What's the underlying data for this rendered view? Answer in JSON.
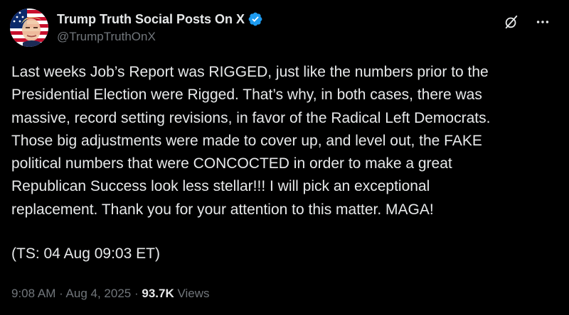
{
  "author": {
    "display_name": "Trump Truth Social Posts On X",
    "handle": "@TrumpTruthOnX",
    "verified": true
  },
  "post": {
    "text": "Last weeks Job’s Report was RIGGED, just like the numbers prior to the\nPresidential Election were Rigged. That’s why, in both cases, there was\nmassive, record setting revisions, in favor of the Radical Left Democrats.\nThose big adjustments were made to cover up, and level out, the FAKE\npolitical numbers that were CONCOCTED in order to make a great\nRepublican Success look less stellar!!! I will pick an exceptional\nreplacement. Thank you for your attention to this matter. MAGA!",
    "timestamp_line": "(TS: 04 Aug 09:03 ET)"
  },
  "meta": {
    "time": "9:08 AM",
    "separator": " · ",
    "date": "Aug 4, 2025",
    "views_count": "93.7K",
    "views_label": " Views"
  },
  "icons": {
    "avatar": "flag-portrait-avatar",
    "verified": "verified-badge-icon",
    "grok": "grok-icon",
    "more": "more-icon"
  },
  "colors": {
    "background": "#000000",
    "text": "#e7e9ea",
    "secondary": "#71767b",
    "verified_blue": "#1d9bf0"
  }
}
